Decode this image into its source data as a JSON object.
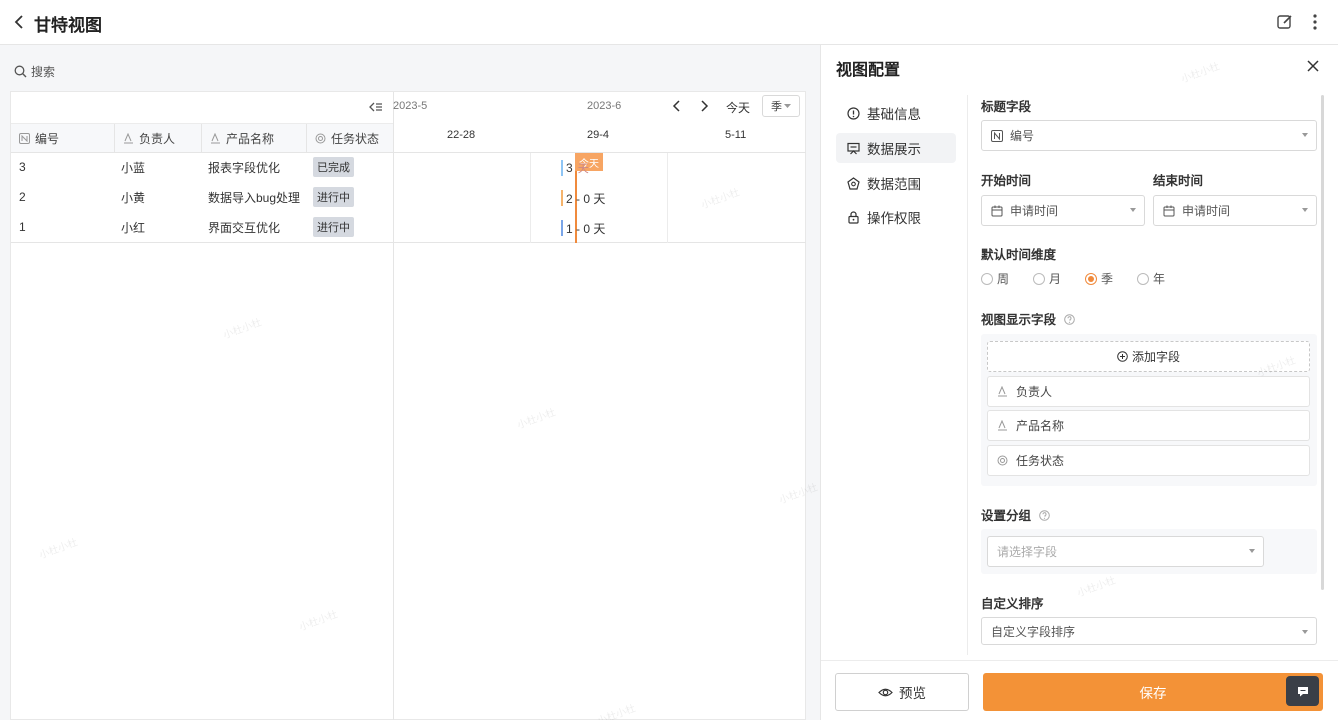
{
  "header": {
    "title": "甘特视图"
  },
  "search": {
    "label": "搜索"
  },
  "table": {
    "columns": [
      "编号",
      "负责人",
      "产品名称",
      "任务状态"
    ],
    "rows": [
      {
        "id": "3",
        "owner": "小蓝",
        "product": "报表字段优化",
        "status": "已完成"
      },
      {
        "id": "2",
        "owner": "小黄",
        "product": "数据导入bug处理",
        "status": "进行中"
      },
      {
        "id": "1",
        "owner": "小红",
        "product": "界面交互优化",
        "status": "进行中"
      }
    ]
  },
  "timeline": {
    "months": [
      "2023-5",
      "2023-6"
    ],
    "weeks": [
      "22-28",
      "29-4",
      "5-11"
    ],
    "today_label": "今天",
    "scale_value": "季",
    "today_marker": "今天",
    "bars": [
      {
        "label": "3",
        "color": "#8ec5f5"
      },
      {
        "label": "2 - 0 天",
        "color": "#f5b36b"
      },
      {
        "label": "1 - 0 天",
        "color": "#7aa5e8"
      }
    ],
    "overlap_text": "天"
  },
  "panel": {
    "title": "视图配置",
    "nav": [
      "基础信息",
      "数据展示",
      "数据范围",
      "操作权限"
    ],
    "title_field": {
      "label": "标题字段",
      "value": "编号"
    },
    "start_time": {
      "label": "开始时间",
      "value": "申请时间"
    },
    "end_time": {
      "label": "结束时间",
      "value": "申请时间"
    },
    "time_dimension": {
      "label": "默认时间维度",
      "options": [
        "周",
        "月",
        "季",
        "年"
      ],
      "selected": "季"
    },
    "display_fields": {
      "label": "视图显示字段",
      "add_label": "添加字段",
      "items": [
        "负责人",
        "产品名称",
        "任务状态"
      ]
    },
    "grouping": {
      "label": "设置分组",
      "placeholder": "请选择字段"
    },
    "sorting": {
      "label": "自定义排序",
      "value": "自定义字段排序"
    },
    "footer": {
      "preview": "预览",
      "save": "保存"
    }
  },
  "watermark": "小杜小杜",
  "colors": {
    "accent": "#f39237",
    "today": "#f08a3c"
  }
}
